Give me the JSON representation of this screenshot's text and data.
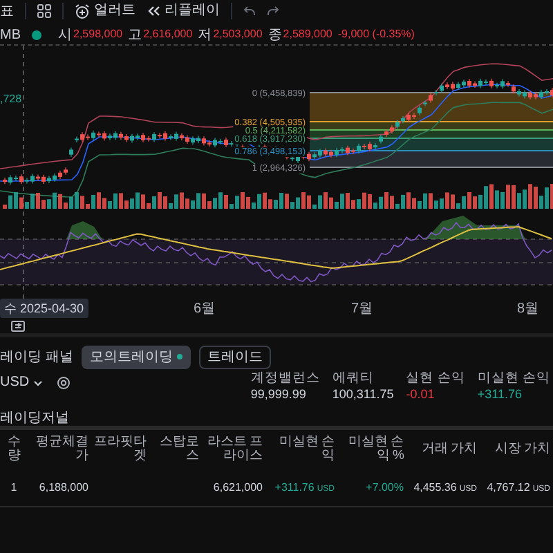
{
  "toolbar": {
    "items": [
      {
        "kind": "text",
        "label": "표"
      },
      {
        "kind": "layout"
      },
      {
        "kind": "alert",
        "label": "얼러트"
      },
      {
        "kind": "replay",
        "label": "리플레이"
      },
      {
        "kind": "undo"
      },
      {
        "kind": "redo"
      }
    ]
  },
  "legend": {
    "symbol": "MB",
    "fields": [
      {
        "label": "시",
        "value": "2,598,000"
      },
      {
        "label": "고",
        "value": "2,616,000"
      },
      {
        "label": "저",
        "value": "2,503,000"
      },
      {
        "label": "종",
        "value": "2,589,000"
      }
    ],
    "change": "-9,000 (-0.35%)"
  },
  "chart": {
    "price_label": ",728",
    "fib_levels": [
      {
        "label": "0 (5,458,839)",
        "color": "#8a8d96"
      },
      {
        "label": "0.382 (4,505,935)",
        "color": "#e0a030"
      },
      {
        "label": "0.5 (4,211,582)",
        "color": "#5fb35f"
      },
      {
        "label": "0.618 (3,917,230)",
        "color": "#3f9e7a"
      },
      {
        "label": "0.786 (3,498,153)",
        "color": "#2a8fbf"
      },
      {
        "label": "1 (2,964,326)",
        "color": "#8a8d96"
      }
    ],
    "time_labels": [
      {
        "kind": "cursor",
        "text": "수 2025-04-30"
      },
      {
        "kind": "month",
        "text": "6월"
      },
      {
        "kind": "month",
        "text": "7월"
      },
      {
        "kind": "month",
        "text": "8월"
      }
    ]
  },
  "panel": {
    "title": "레이딩 패널",
    "tabs": [
      {
        "label": "모의트레이딩",
        "selected": true
      },
      {
        "label": "트레이드",
        "selected": false
      }
    ]
  },
  "account": {
    "currency": "USD",
    "stats": [
      {
        "label": "계정밸런스",
        "value": "99,999.99",
        "color": "#d1d4dc"
      },
      {
        "label": "에쿼티",
        "value": "100,311.75",
        "color": "#d1d4dc"
      },
      {
        "label": "실현 손익",
        "value": "-0.01",
        "color": "#f23645"
      },
      {
        "label": "미실현 손익",
        "value": "+311.76",
        "color": "#22ab94"
      }
    ]
  },
  "journal": {
    "title": "레이딩저널",
    "columns": [
      "수량",
      "평균체결가",
      "프라핏타겟",
      "스탑로스",
      "라스트 프라이스",
      "미실현 손익",
      "미실현 손익 %",
      "거래 가치",
      "시장 가치"
    ],
    "rows": [
      {
        "cells": [
          {
            "text": "1",
            "color": "#d1d4dc"
          },
          {
            "text": "6,188,000",
            "color": "#d1d4dc"
          },
          {},
          {},
          {
            "text": "6,621,000",
            "color": "#d1d4dc"
          },
          {
            "text": "+311.76",
            "unit": "USD",
            "color": "#22ab94"
          },
          {
            "text": "+7.00%",
            "color": "#22ab94"
          },
          {
            "text": "4,455.36",
            "unit": "USD",
            "color": "#d1d4dc"
          },
          {
            "text": "4,767.12",
            "unit": "USD",
            "color": "#d1d4dc"
          }
        ]
      }
    ]
  }
}
